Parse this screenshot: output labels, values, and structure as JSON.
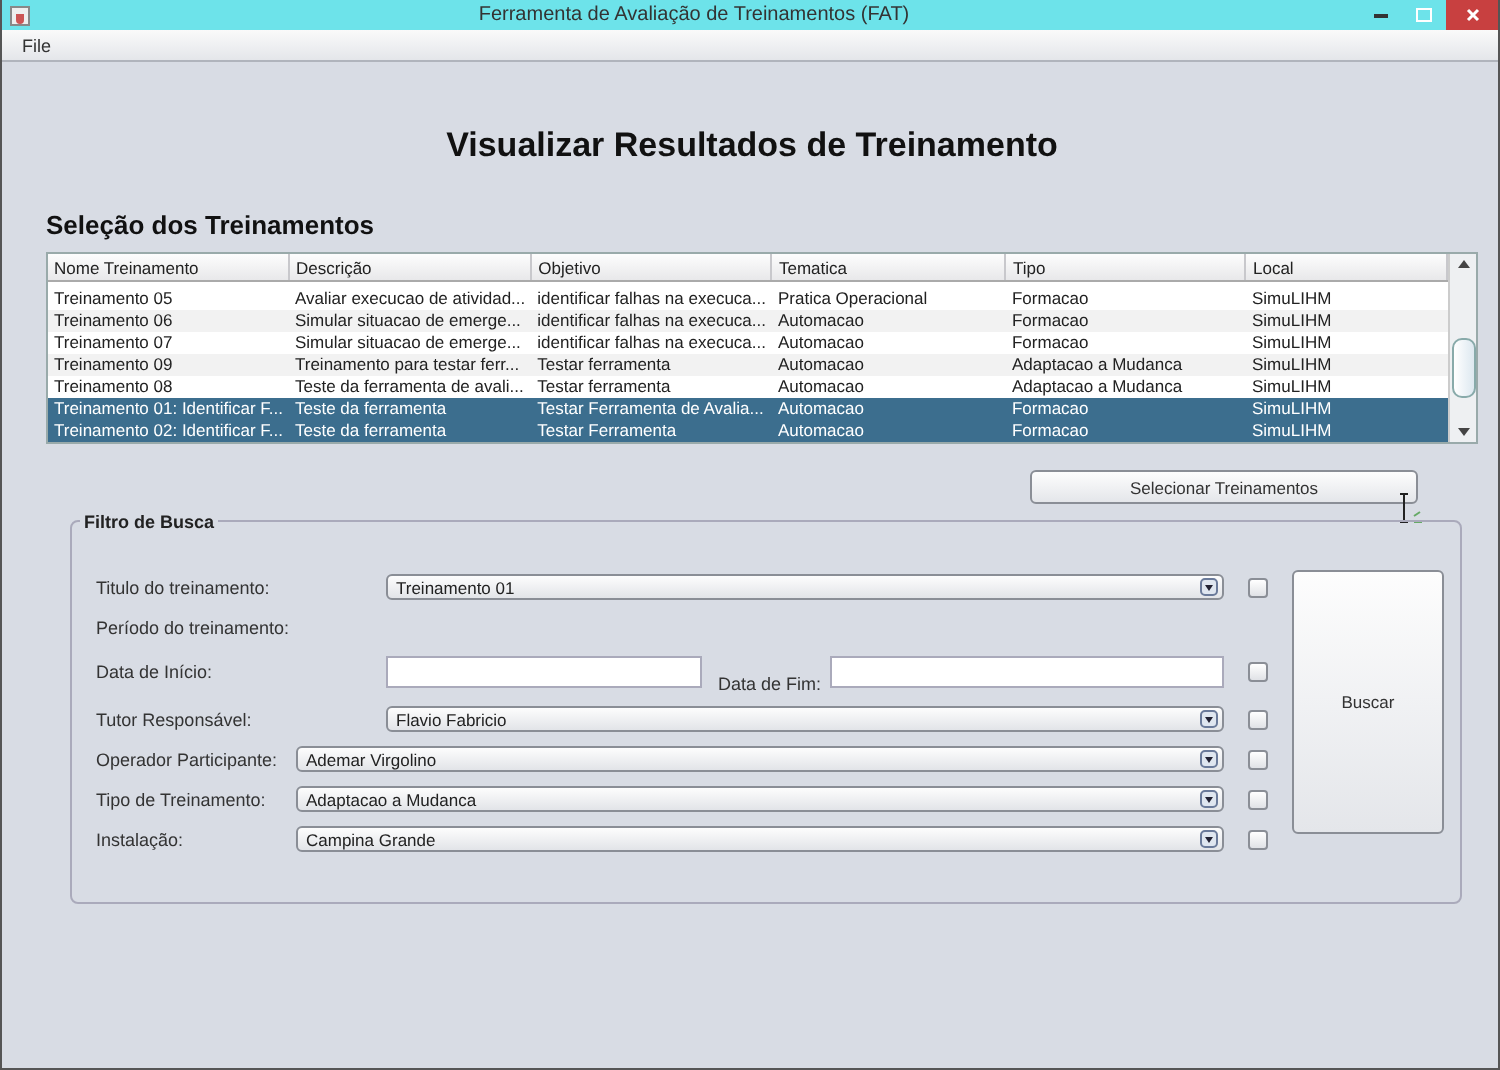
{
  "window": {
    "title": "Ferramenta de Avaliação de Treinamentos (FAT)"
  },
  "menu": [
    "File"
  ],
  "heading": "Visualizar Resultados de Treinamento",
  "selection": {
    "title": "Seleção dos Treinamentos",
    "columns": [
      "Nome Treinamento",
      "Descrição",
      "Objetivo",
      "Tematica",
      "Tipo",
      "Local"
    ],
    "rows": [
      {
        "cells": [
          "Treinamento 05",
          "Avaliar execucao de atividad...",
          "identificar falhas na execuca...",
          "Pratica Operacional",
          "Formacao",
          "SimuLIHM"
        ],
        "selected": false
      },
      {
        "cells": [
          "Treinamento 06",
          "Simular situacao de emerge...",
          "identificar falhas na execuca...",
          "Automacao",
          "Formacao",
          "SimuLIHM"
        ],
        "selected": false
      },
      {
        "cells": [
          "Treinamento 07",
          "Simular situacao de emerge...",
          "identificar falhas na execuca...",
          "Automacao",
          "Formacao",
          "SimuLIHM"
        ],
        "selected": false
      },
      {
        "cells": [
          "Treinamento 09",
          "Treinamento para testar ferr...",
          "Testar ferramenta",
          "Automacao",
          "Adaptacao a Mudanca",
          "SimuLIHM"
        ],
        "selected": false
      },
      {
        "cells": [
          "Treinamento 08",
          "Teste da ferramenta de avali...",
          "Testar ferramenta",
          "Automacao",
          "Adaptacao a Mudanca",
          "SimuLIHM"
        ],
        "selected": false
      },
      {
        "cells": [
          "Treinamento 01: Identificar F...",
          "Teste da ferramenta",
          "Testar Ferramenta de Avalia...",
          "Automacao",
          "Formacao",
          "SimuLIHM"
        ],
        "selected": true
      },
      {
        "cells": [
          "Treinamento 02: Identificar F...",
          "Teste da ferramenta",
          "Testar Ferramenta",
          "Automacao",
          "Formacao",
          "SimuLIHM"
        ],
        "selected": true
      }
    ],
    "button": "Selecionar Treinamentos"
  },
  "filter": {
    "title": "Filtro de Busca",
    "rows": [
      {
        "kind": "combo",
        "label": "Titulo do treinamento:",
        "value": "Treinamento 01",
        "checked": false
      },
      {
        "kind": "heading",
        "label": "Período do treinamento:"
      },
      {
        "kind": "date",
        "label": "Data de Início:",
        "end_label": "Data de Fim:",
        "checked": false
      },
      {
        "kind": "combo",
        "label": "Tutor Responsável:",
        "value": "Flavio Fabricio",
        "checked": false
      },
      {
        "kind": "wide",
        "label": "Operador Participante:",
        "value": "Ademar Virgolino",
        "checked": false
      },
      {
        "kind": "wide",
        "label": "Tipo de Treinamento:",
        "value": "Adaptacao a Mudanca",
        "checked": false
      },
      {
        "kind": "wide",
        "label": "Instalação:",
        "value": "Campina Grande",
        "checked": false
      }
    ],
    "button": "Buscar"
  }
}
